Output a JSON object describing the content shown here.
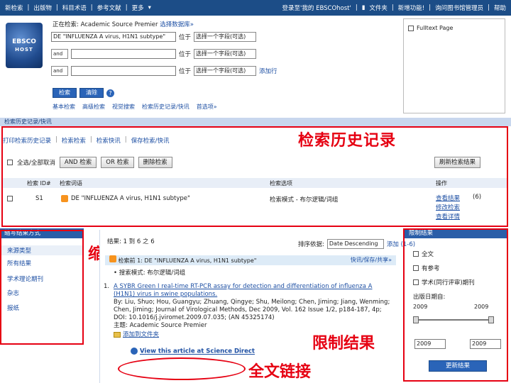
{
  "topnav": {
    "left": [
      "新检索",
      "出版物",
      "科目术语",
      "参考文献",
      "更多"
    ],
    "more_arrow": "▾",
    "right": [
      "登录至'我的 EBSCOhost'",
      "文件夹",
      "新增功能!",
      "询问图书馆管理员",
      "帮助"
    ]
  },
  "logo": {
    "line1": "EBSCO",
    "line2": "HOST"
  },
  "search": {
    "db_line": "正在检索: Academic Source Premier",
    "db_link": "选择数据库»",
    "rows": [
      {
        "bool": "",
        "query": "DE \"INFLUENZA A virus, H1N1 subtype\"",
        "in": "位于",
        "field": "选择一个字段(可选)"
      },
      {
        "bool": "and",
        "query": "",
        "in": "位于",
        "field": "选择一个字段(可选)"
      },
      {
        "bool": "and",
        "query": "",
        "in": "位于",
        "field": "选择一个字段(可选)"
      }
    ],
    "add_row": "添加行",
    "search_btn": "检索",
    "clear_btn": "清除",
    "help": "?",
    "links": [
      "基本检索",
      "高级检索",
      "视觉搜索",
      "检索历史记录/快讯",
      "首选项»"
    ],
    "fulltext_label": "Fulltext Page"
  },
  "history": {
    "bar": "检索历史记录/快讯",
    "links": [
      "打印检索历史记录",
      "检索检索",
      "检索快讯",
      "保存检索/快讯"
    ],
    "select_all": "全选/全部取消",
    "and_btn": "AND 检索",
    "or_btn": "OR 检索",
    "delete_btn": "删除检索",
    "refresh_btn": "刷新检索结果",
    "columns": [
      "检索 ID#",
      "检索词语",
      "检索选项",
      "操作"
    ],
    "row": {
      "id": "S1",
      "terms": "DE \"INFLUENZA A virus, H1N1 subtype\"",
      "options": "检索模式 - 布尔逻辑/词组",
      "view_results": "查看结果",
      "count": "(6)",
      "edit": "修改检索",
      "details": "查看详情"
    },
    "annotation": "检索历史记录"
  },
  "refine": {
    "header": "缩写结果方式",
    "items": [
      "来源类型",
      "所有结果",
      "学术理论期刊",
      "杂志",
      "报纸"
    ],
    "annotation": "缩写结果"
  },
  "results": {
    "header": "结果: 1 到 6 之 6",
    "sort_label": "排序依据:",
    "sort_value": "Date Descending",
    "add_label": "添加 (1-6)",
    "strip": "检索前 1: DE \"INFLUENZA A virus, H1N1 subtype\"",
    "strip_right": "快讯/保存/共享»",
    "mode_line": "• 搜索模式: 布尔逻辑/词组",
    "item": {
      "number": "1.",
      "title": "A SYBR Green I real-time RT-PCR assay for detection and differentiation of influenza A (H1N1) virus in swine populations.",
      "authors": "By: Liu, Shuo; Hou, Guangyu; Zhuang, Qingye; Shu, Meilong; Chen, Jiming; Jiang, Wenming; Chen, Jiming; Journal of Virological Methods, Dec 2009, Vol. 162 Issue 1/2, p184-187, 4p; DOI: 10.1016/j.jviromet.2009.07.035; (AN 45325174)",
      "subjects": "主题: Academic Source Premier",
      "folder": "添加到文件夹",
      "fulltext_link": "View this article at Science Direct"
    },
    "annotation_limit": "限制结果",
    "annotation_fulltext": "全文链接"
  },
  "limit": {
    "header": "限制结果",
    "options": [
      "全文",
      "有参考",
      "学术(同行评审)期刊"
    ],
    "date_label": "出版日期自:",
    "from_min": "2009",
    "to_max": "2009",
    "from_value": "2009",
    "to_value": "2009",
    "update_btn": "更新结果"
  }
}
